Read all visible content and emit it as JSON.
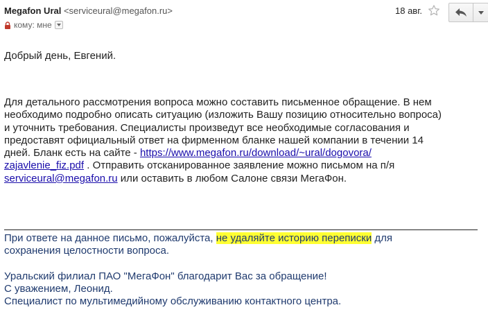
{
  "header": {
    "sender_name": "Megafon Ural",
    "sender_email": "<serviceural@megafon.ru>",
    "to_label": "кому: мне",
    "date": "18 авг."
  },
  "icons": {
    "lock": "lock-icon",
    "to_dropdown": "chevron-down-icon",
    "star": "star-icon",
    "reply": "reply-arrow-icon",
    "more": "caret-down-icon"
  },
  "body": {
    "greeting": "Добрый день, Евгений.",
    "para_line1": "Для детального рассмотрения вопроса можно составить письменное обращение. В нем",
    "para_line2": "необходимо подробно описать ситуацию (изложить Вашу позицию относительно вопроса)",
    "para_line3": "и уточнить требования. Специалисты произведут все необходимые согласования и",
    "para_line4": "предоставят официальный ответ на фирменном бланке нашей компании в течении 14",
    "para_line5_pre": "дней. Бланк есть на сайте - ",
    "link_url_part1": "https://www.megafon.ru/download/~ural/dogovora/",
    "link_url_part2": "zajavlenie_fiz.pdf",
    "para_line6_post": " . Отправить отсканированное заявление можно письмом на п/я",
    "email_link": "serviceural@megafon.ru",
    "para_line7_post": "  или оставить в любом Салоне связи МегаФон."
  },
  "signature": {
    "line1_pre": "При ответе на данное письмо, пожалуйста, ",
    "line1_highlight": "не удаляйте историю переписки",
    "line1_post": " для",
    "line2": "сохранения целостности вопроса.",
    "line3": "Уральский филиал ПАО \"МегаФон\" благодарит Вас за обращение!",
    "line4": "С уважением, Леонид.",
    "line5": "Специалист по мультимедийному обслуживанию контактного центра."
  },
  "colors": {
    "link": "#1a0dab",
    "signature_text": "#1f3a6e",
    "highlight": "#ffff33"
  }
}
